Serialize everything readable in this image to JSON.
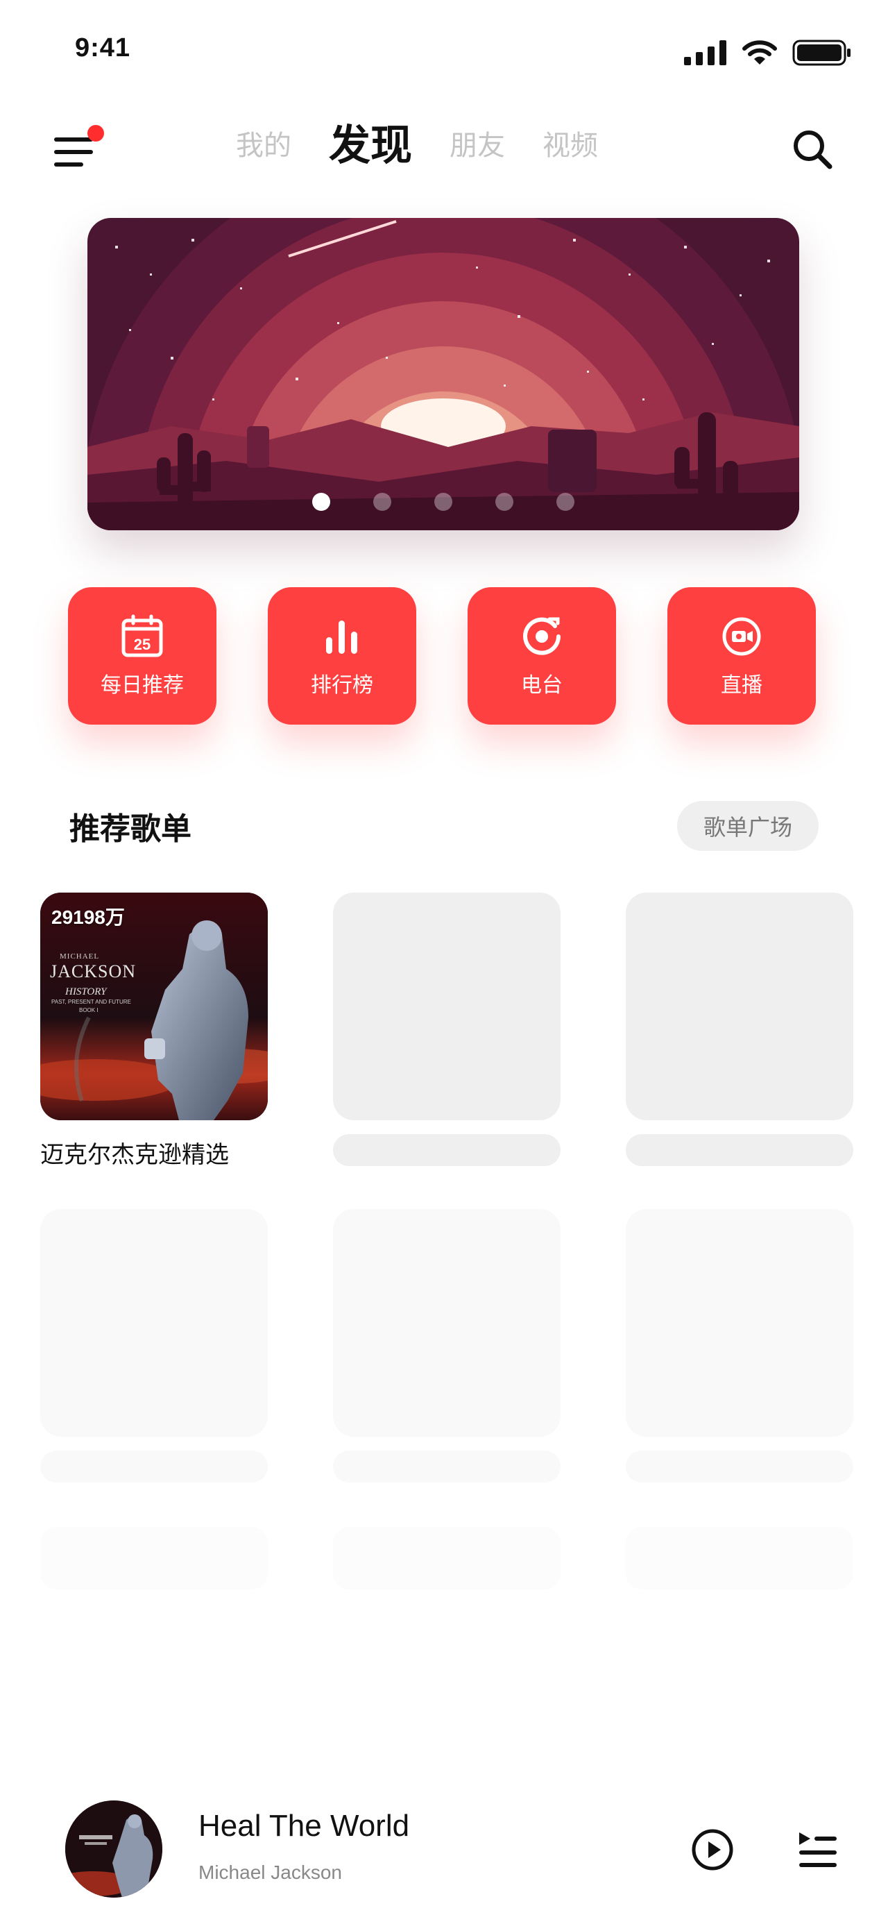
{
  "status_bar": {
    "time": "9:41"
  },
  "header": {
    "tabs": [
      {
        "label": "我的"
      },
      {
        "label": "发现"
      },
      {
        "label": "朋友"
      },
      {
        "label": "视频"
      }
    ]
  },
  "banner": {
    "page_count": 5,
    "active_index": 0
  },
  "quick_actions": [
    {
      "label": "每日推荐",
      "icon": "calendar-icon",
      "day": "25"
    },
    {
      "label": "排行榜",
      "icon": "chart-bars-icon"
    },
    {
      "label": "电台",
      "icon": "radio-icon"
    },
    {
      "label": "直播",
      "icon": "live-camera-icon"
    }
  ],
  "playlists_section": {
    "title": "推荐歌单",
    "more_label": "歌单广场",
    "cards": [
      {
        "play_count": "29198万",
        "name": "迈克尔杰克逊精选",
        "cover": {
          "artist": "MICHAEL",
          "title": "JACKSON",
          "album": "HISTORY",
          "sub": "PAST, PRESENT AND FUTURE",
          "book": "BOOK I"
        }
      }
    ]
  },
  "player": {
    "title": "Heal The World",
    "artist": "Michael Jackson"
  },
  "colors": {
    "accent": "#ff4040",
    "placeholder": "#efefef"
  }
}
